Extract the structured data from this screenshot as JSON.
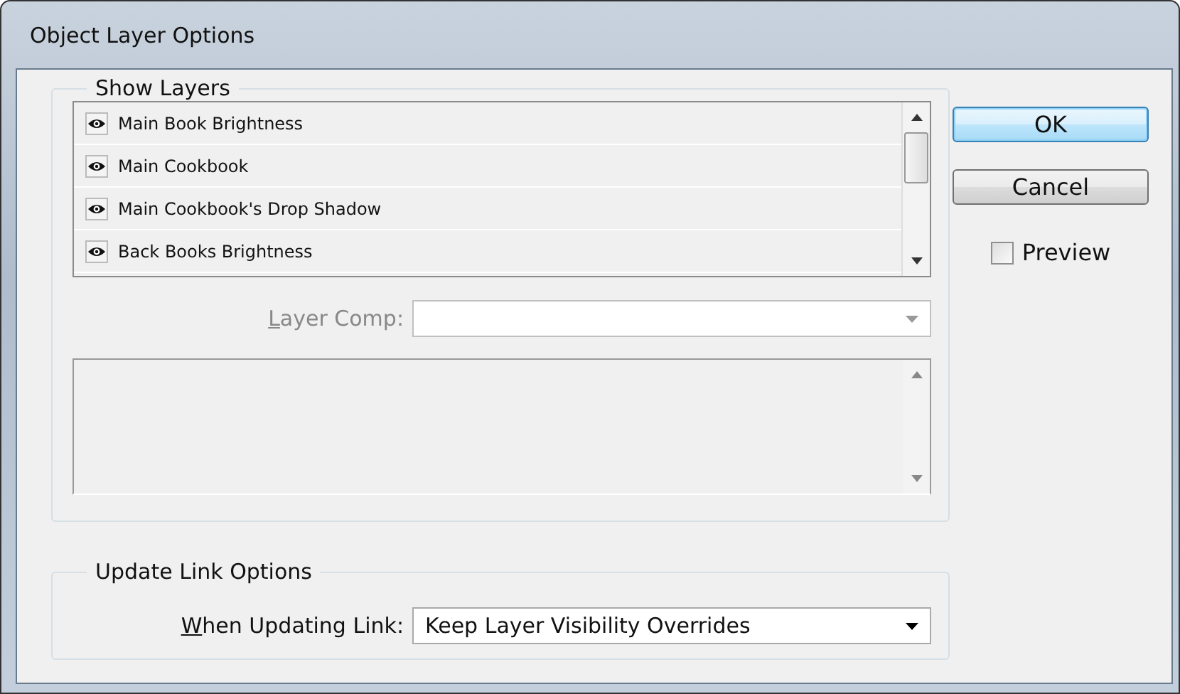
{
  "window": {
    "title": "Object Layer Options"
  },
  "show_layers": {
    "title": "Show Layers",
    "layers": [
      {
        "name": "Main Book Brightness",
        "visible": true
      },
      {
        "name": "Main Cookbook",
        "visible": true
      },
      {
        "name": "Main Cookbook's Drop Shadow",
        "visible": true
      },
      {
        "name": "Back Books Brightness",
        "visible": true
      }
    ],
    "layer_comp": {
      "label": "Layer Comp:",
      "disabled": true
    }
  },
  "update_link_options": {
    "title": "Update Link Options",
    "label": "When Updating Link:",
    "value": "Keep Layer Visibility Overrides"
  },
  "buttons": [
    {
      "label": "OK",
      "default": true
    },
    {
      "label": "Cancel",
      "default": false
    }
  ],
  "preview": {
    "label": "Preview",
    "checked": false
  }
}
